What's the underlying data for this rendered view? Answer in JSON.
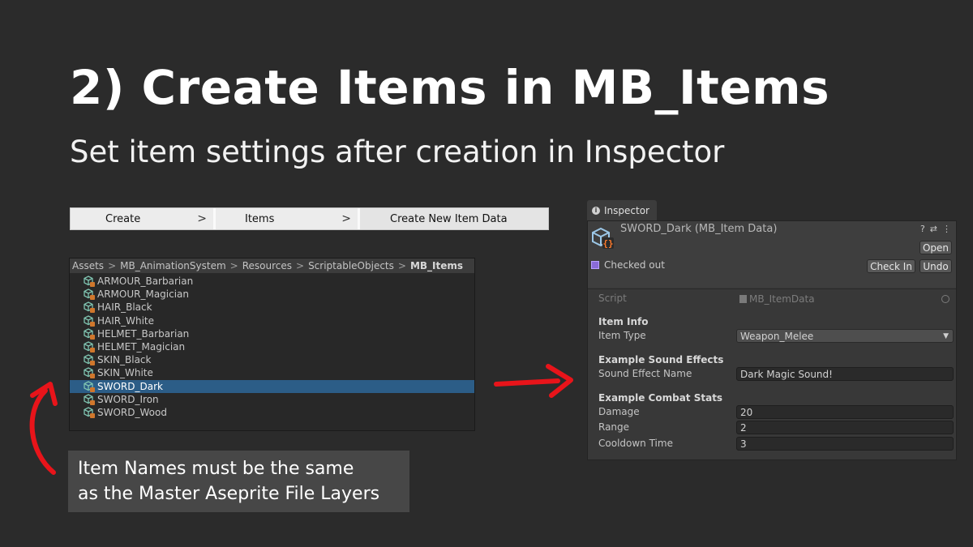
{
  "slide": {
    "title": "2) Create Items in MB_Items",
    "subtitle": "Set item settings after creation in Inspector",
    "note_line1": "Item Names must be the same",
    "note_line2": "as the Master Aseprite File Layers",
    "arrow_color": "#e8141a"
  },
  "menu": {
    "items": [
      {
        "label": "Create",
        "arrow": ">"
      },
      {
        "label": "Items",
        "arrow": ">"
      },
      {
        "label": "Create New Item Data"
      }
    ]
  },
  "project": {
    "breadcrumb": [
      "Assets",
      "MB_AnimationSystem",
      "Resources",
      "ScriptableObjects",
      "MB_Items"
    ],
    "separator": ">",
    "assets": [
      {
        "name": "ARMOUR_Barbarian",
        "icon": "scriptable-object-icon"
      },
      {
        "name": "ARMOUR_Magician",
        "icon": "scriptable-object-icon"
      },
      {
        "name": "HAIR_Black",
        "icon": "scriptable-object-icon"
      },
      {
        "name": "HAIR_White",
        "icon": "scriptable-object-icon"
      },
      {
        "name": "HELMET_Barbarian",
        "icon": "scriptable-object-icon"
      },
      {
        "name": "HELMET_Magician",
        "icon": "scriptable-object-icon"
      },
      {
        "name": "SKIN_Black",
        "icon": "scriptable-object-icon"
      },
      {
        "name": "SKIN_White",
        "icon": "scriptable-object-icon"
      },
      {
        "name": "SWORD_Dark",
        "icon": "scriptable-object-icon",
        "selected": true
      },
      {
        "name": "SWORD_Iron",
        "icon": "scriptable-object-icon"
      },
      {
        "name": "SWORD_Wood",
        "icon": "scriptable-object-icon"
      }
    ],
    "selection_color": "#2c5d87"
  },
  "inspector": {
    "tab_label": "Inspector",
    "object_title": "SWORD_Dark (MB_Item Data)",
    "open_button": "Open",
    "status": "Checked out",
    "checkin_button": "Check In",
    "undo_button": "Undo",
    "script_label": "Script",
    "script_value": "MB_ItemData",
    "section_item_info": "Item Info",
    "item_type_label": "Item Type",
    "item_type_value": "Weapon_Melee",
    "section_sound": "Example Sound Effects",
    "sound_label": "Sound Effect Name",
    "sound_value": "Dark Magic Sound!",
    "section_combat": "Example Combat Stats",
    "damage_label": "Damage",
    "damage_value": "20",
    "range_label": "Range",
    "range_value": "2",
    "cooldown_label": "Cooldown Time",
    "cooldown_value": "3"
  }
}
